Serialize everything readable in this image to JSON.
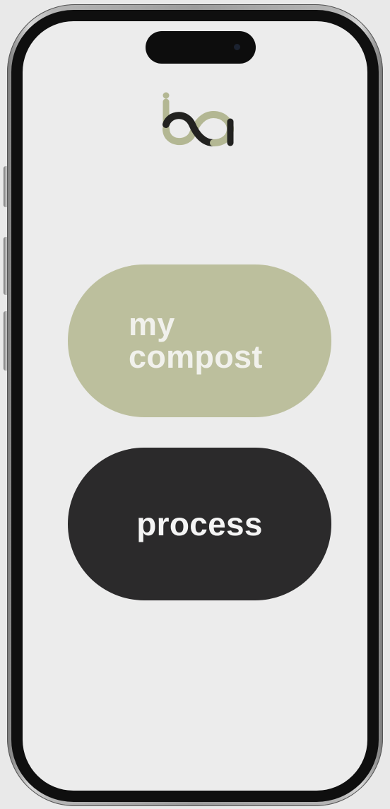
{
  "app": {
    "logo_text": "ba"
  },
  "buttons": {
    "my_compost_line1": "my",
    "my_compost_line2": "compost",
    "process_label": "process"
  },
  "colors": {
    "compost_pill": "#bcbf9d",
    "process_pill": "#2b2a2b",
    "screen_bg": "#ececec",
    "logo_olive": "#b3b793",
    "logo_dark": "#222220"
  },
  "icons": {
    "logo": "ba-logo-icon"
  }
}
